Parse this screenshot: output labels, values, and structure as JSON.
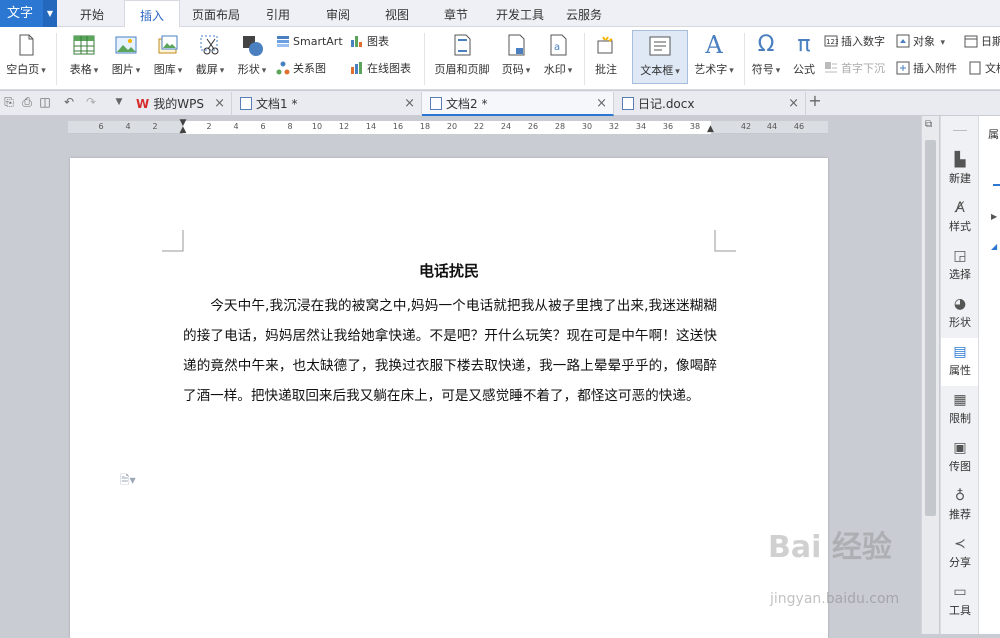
{
  "menubar": {
    "app_button": "文字",
    "tabs": [
      "开始",
      "插入",
      "页面布局",
      "引用",
      "审阅",
      "视图",
      "章节",
      "开发工具",
      "云服务"
    ],
    "active_tab": "插入"
  },
  "ribbon": {
    "blank_page": "空白页",
    "table": "表格",
    "picture": "图片",
    "gallery": "图库",
    "screenshot": "截屏",
    "shapes": "形状",
    "smartart": "SmartArt",
    "chart": "图表",
    "relation_chart": "关系图",
    "online_chart": "在线图表",
    "header_footer": "页眉和页脚",
    "page_number": "页码",
    "watermark": "水印",
    "comment": "批注",
    "textbox": "文本框",
    "wordart": "艺术字",
    "symbol": "符号",
    "formula": "公式",
    "insert_number": "插入数字",
    "object": "对象",
    "date_partial": "日期",
    "drop_cap": "首字下沉",
    "insert_attachment": "插入附件",
    "doc_partial": "文档"
  },
  "doc_tabs": [
    {
      "label": "我的WPS",
      "active": false
    },
    {
      "label": "文档1 *",
      "active": false
    },
    {
      "label": "文档2 *",
      "active": true
    },
    {
      "label": "日记.docx",
      "active": false
    }
  ],
  "ruler_ticks": [
    "6",
    "4",
    "2",
    "2",
    "4",
    "6",
    "8",
    "10",
    "12",
    "14",
    "16",
    "18",
    "20",
    "22",
    "24",
    "26",
    "28",
    "30",
    "32",
    "34",
    "36",
    "38",
    "42",
    "44",
    "46"
  ],
  "document": {
    "title": "电话扰民",
    "paragraph": "今天中午,我沉浸在我的被窝之中,妈妈一个电话就把我从被子里拽了出来,我迷迷糊糊的接了电话，妈妈居然让我给她拿快递。不是吧？开什么玩笑？现在可是中午啊！这送快递的竟然中午来，也太缺德了，我换过衣服下楼去取快递，我一路上晕晕乎乎的，像喝醉了酒一样。把快递取回来后我又躺在床上，可是又感觉睡不着了，都怪这可恶的快递。"
  },
  "side_panel": [
    {
      "label": "新建",
      "icon": "new-doc-icon"
    },
    {
      "label": "样式",
      "icon": "style-icon"
    },
    {
      "label": "选择",
      "icon": "select-icon"
    },
    {
      "label": "形状",
      "icon": "shape-icon"
    },
    {
      "label": "属性",
      "icon": "property-icon",
      "active": true
    },
    {
      "label": "限制",
      "icon": "restrict-icon"
    },
    {
      "label": "传图",
      "icon": "upload-image-icon"
    },
    {
      "label": "推荐",
      "icon": "recommend-icon"
    },
    {
      "label": "分享",
      "icon": "share-icon"
    },
    {
      "label": "工具",
      "icon": "tools-icon"
    }
  ],
  "property_panel_partial": "属",
  "watermark": {
    "text": "Bai 经验",
    "sub": "jingyan.baidu.com"
  },
  "colors": {
    "accent": "#2b77d2",
    "page": "#ffffff",
    "workspace": "#c9ccd3"
  }
}
